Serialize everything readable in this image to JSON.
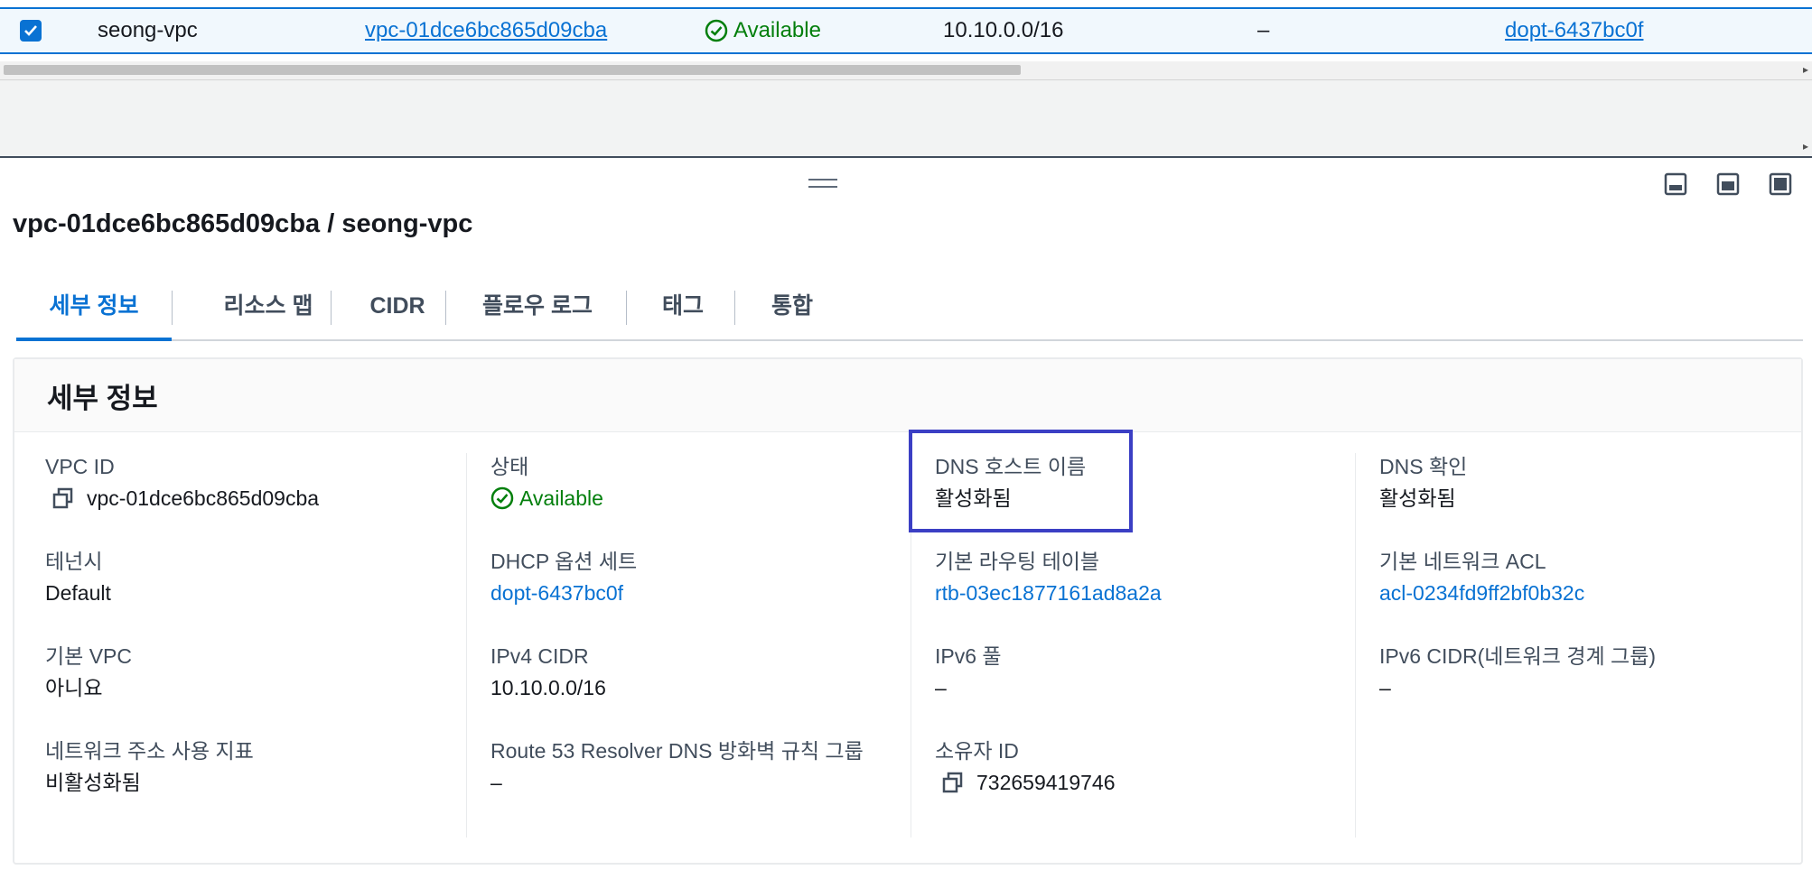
{
  "table_row": {
    "name": "seong-vpc",
    "vpc_id": "vpc-01dce6bc865d09cba",
    "state": "Available",
    "ipv4_cidr": "10.10.0.0/16",
    "ipv6_cidr": "–",
    "dhcp_options": "dopt-6437bc0f",
    "selected": true
  },
  "panel": {
    "title": "vpc-01dce6bc865d09cba / seong-vpc",
    "tabs": [
      "세부 정보",
      "리소스 맵",
      "CIDR",
      "플로우 로그",
      "태그",
      "통합"
    ],
    "active_tab": "세부 정보"
  },
  "details": {
    "header": "세부 정보",
    "fields": {
      "vpc_id": {
        "label": "VPC ID",
        "value": "vpc-01dce6bc865d09cba"
      },
      "state": {
        "label": "상태",
        "value": "Available"
      },
      "dns_hostnames": {
        "label": "DNS 호스트 이름",
        "value": "활성화됨"
      },
      "dns_resolution": {
        "label": "DNS 확인",
        "value": "활성화됨"
      },
      "tenancy": {
        "label": "테넌시",
        "value": "Default"
      },
      "dhcp_options": {
        "label": "DHCP 옵션 세트",
        "value": "dopt-6437bc0f"
      },
      "main_route_table": {
        "label": "기본 라우팅 테이블",
        "value": "rtb-03ec1877161ad8a2a"
      },
      "main_network_acl": {
        "label": "기본 네트워크 ACL",
        "value": "acl-0234fd9ff2bf0b32c"
      },
      "default_vpc": {
        "label": "기본 VPC",
        "value": "아니요"
      },
      "ipv4_cidr": {
        "label": "IPv4 CIDR",
        "value": "10.10.0.0/16"
      },
      "ipv6_pool": {
        "label": "IPv6 풀",
        "value": "–"
      },
      "ipv6_cidr": {
        "label": "IPv6 CIDR(네트워크 경계 그룹)",
        "value": "–"
      },
      "network_address_usage": {
        "label": "네트워크 주소 사용 지표",
        "value": "비활성화됨"
      },
      "route53_firewall": {
        "label": "Route 53 Resolver DNS 방화벽 규칙 그룹",
        "value": "–"
      },
      "owner_id": {
        "label": "소유자 ID",
        "value": "732659419746"
      }
    }
  },
  "colors": {
    "link": "#0972d3",
    "success": "#037f0c",
    "highlight_box": "#3b3fc4"
  },
  "icons": [
    "checkbox-checked-icon",
    "status-check-icon",
    "copy-icon",
    "drag-handle-icon",
    "panel-bottom-icon",
    "panel-side-icon",
    "panel-full-icon"
  ]
}
